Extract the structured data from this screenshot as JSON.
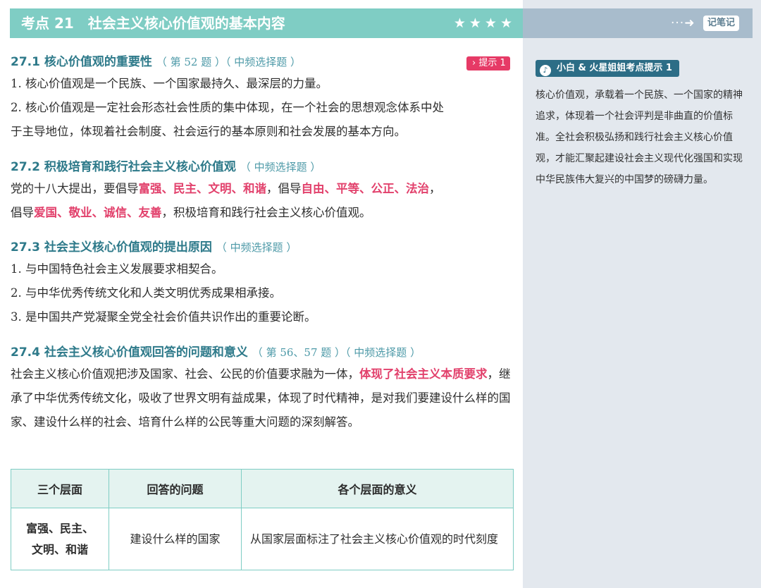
{
  "header": {
    "title": "考点 21　社会主义核心价值观的基本内容",
    "stars": "★★★★",
    "side_arrows": "···➜",
    "side_note": "记笔记"
  },
  "tip_badge": "› 提示 1",
  "sections": {
    "s1": {
      "title": "27.1  核心价值观的重要性",
      "note": "（ 第 52 题 ）（ 中频选择题 ）",
      "lines": [
        "1. 核心价值观是一个民族、一个国家最持久、最深层的力量。",
        "2. 核心价值观是一定社会形态社会性质的集中体现，在一个社会的思想观念体系中处",
        "于主导地位，体现着社会制度、社会运行的基本原则和社会发展的基本方向。"
      ]
    },
    "s2": {
      "title": "27.2  积极培育和践行社会主义核心价值观",
      "note": "（ 中频选择题 ）",
      "l1": {
        "a": "党的十八大提出，要倡导",
        "b": "富强、民主、文明、和谐",
        "c": "，倡导",
        "d": "自由、平等、公正、法治",
        "e": "，"
      },
      "l2": {
        "a": "倡导",
        "b": "爱国、敬业、诚信、友善",
        "c": "，积极培育和践行社会主义核心价值观。"
      }
    },
    "s3": {
      "title": "27.3  社会主义核心价值观的提出原因",
      "note": "（ 中频选择题 ）",
      "lines": [
        "1. 与中国特色社会主义发展要求相契合。",
        "2. 与中华优秀传统文化和人类文明优秀成果相承接。",
        "3. 是中国共产党凝聚全党全社会价值共识作出的重要论断。"
      ]
    },
    "s4": {
      "title": "27.4  社会主义核心价值观回答的问题和意义",
      "note": "（ 第 56、57 题 ）（ 中频选择题 ）",
      "p": {
        "a": "社会主义核心价值观把涉及国家、社会、公民的价值要求融为一体，",
        "b": "体现了社会主义本质要求",
        "c": "，继承了中华优秀传统文化，吸收了世界文明有益成果，体现了时代精神，是对我们要建设什么样的国家、建设什么样的社会、培育什么样的公民等重大问题的深刻解答。"
      }
    }
  },
  "table": {
    "headers": [
      "三个层面",
      "回答的问题",
      "各个层面的意义"
    ],
    "row": {
      "c1a": "富强、民主、",
      "c1b": "文明、和谐",
      "c2": "建设什么样的国家",
      "c3": "从国家层面标注了社会主义核心价值观的时代刻度"
    }
  },
  "sidebar": {
    "badge": "小白 & 火星姐姐考点提示 1",
    "text": "核心价值观，承载着一个民族、一个国家的精神追求，体现着一个社会评判是非曲直的价值标准。全社会积极弘扬和践行社会主义核心价值观，才能汇聚起建设社会主义现代化强国和实现中华民族伟大复兴的中国梦的磅礴力量。"
  },
  "colors": {
    "header_teal": "#7fcdc4",
    "heading_teal": "#2e7a8a",
    "highlight_red": "#e2416c",
    "side_gray": "#e3e8ee"
  }
}
